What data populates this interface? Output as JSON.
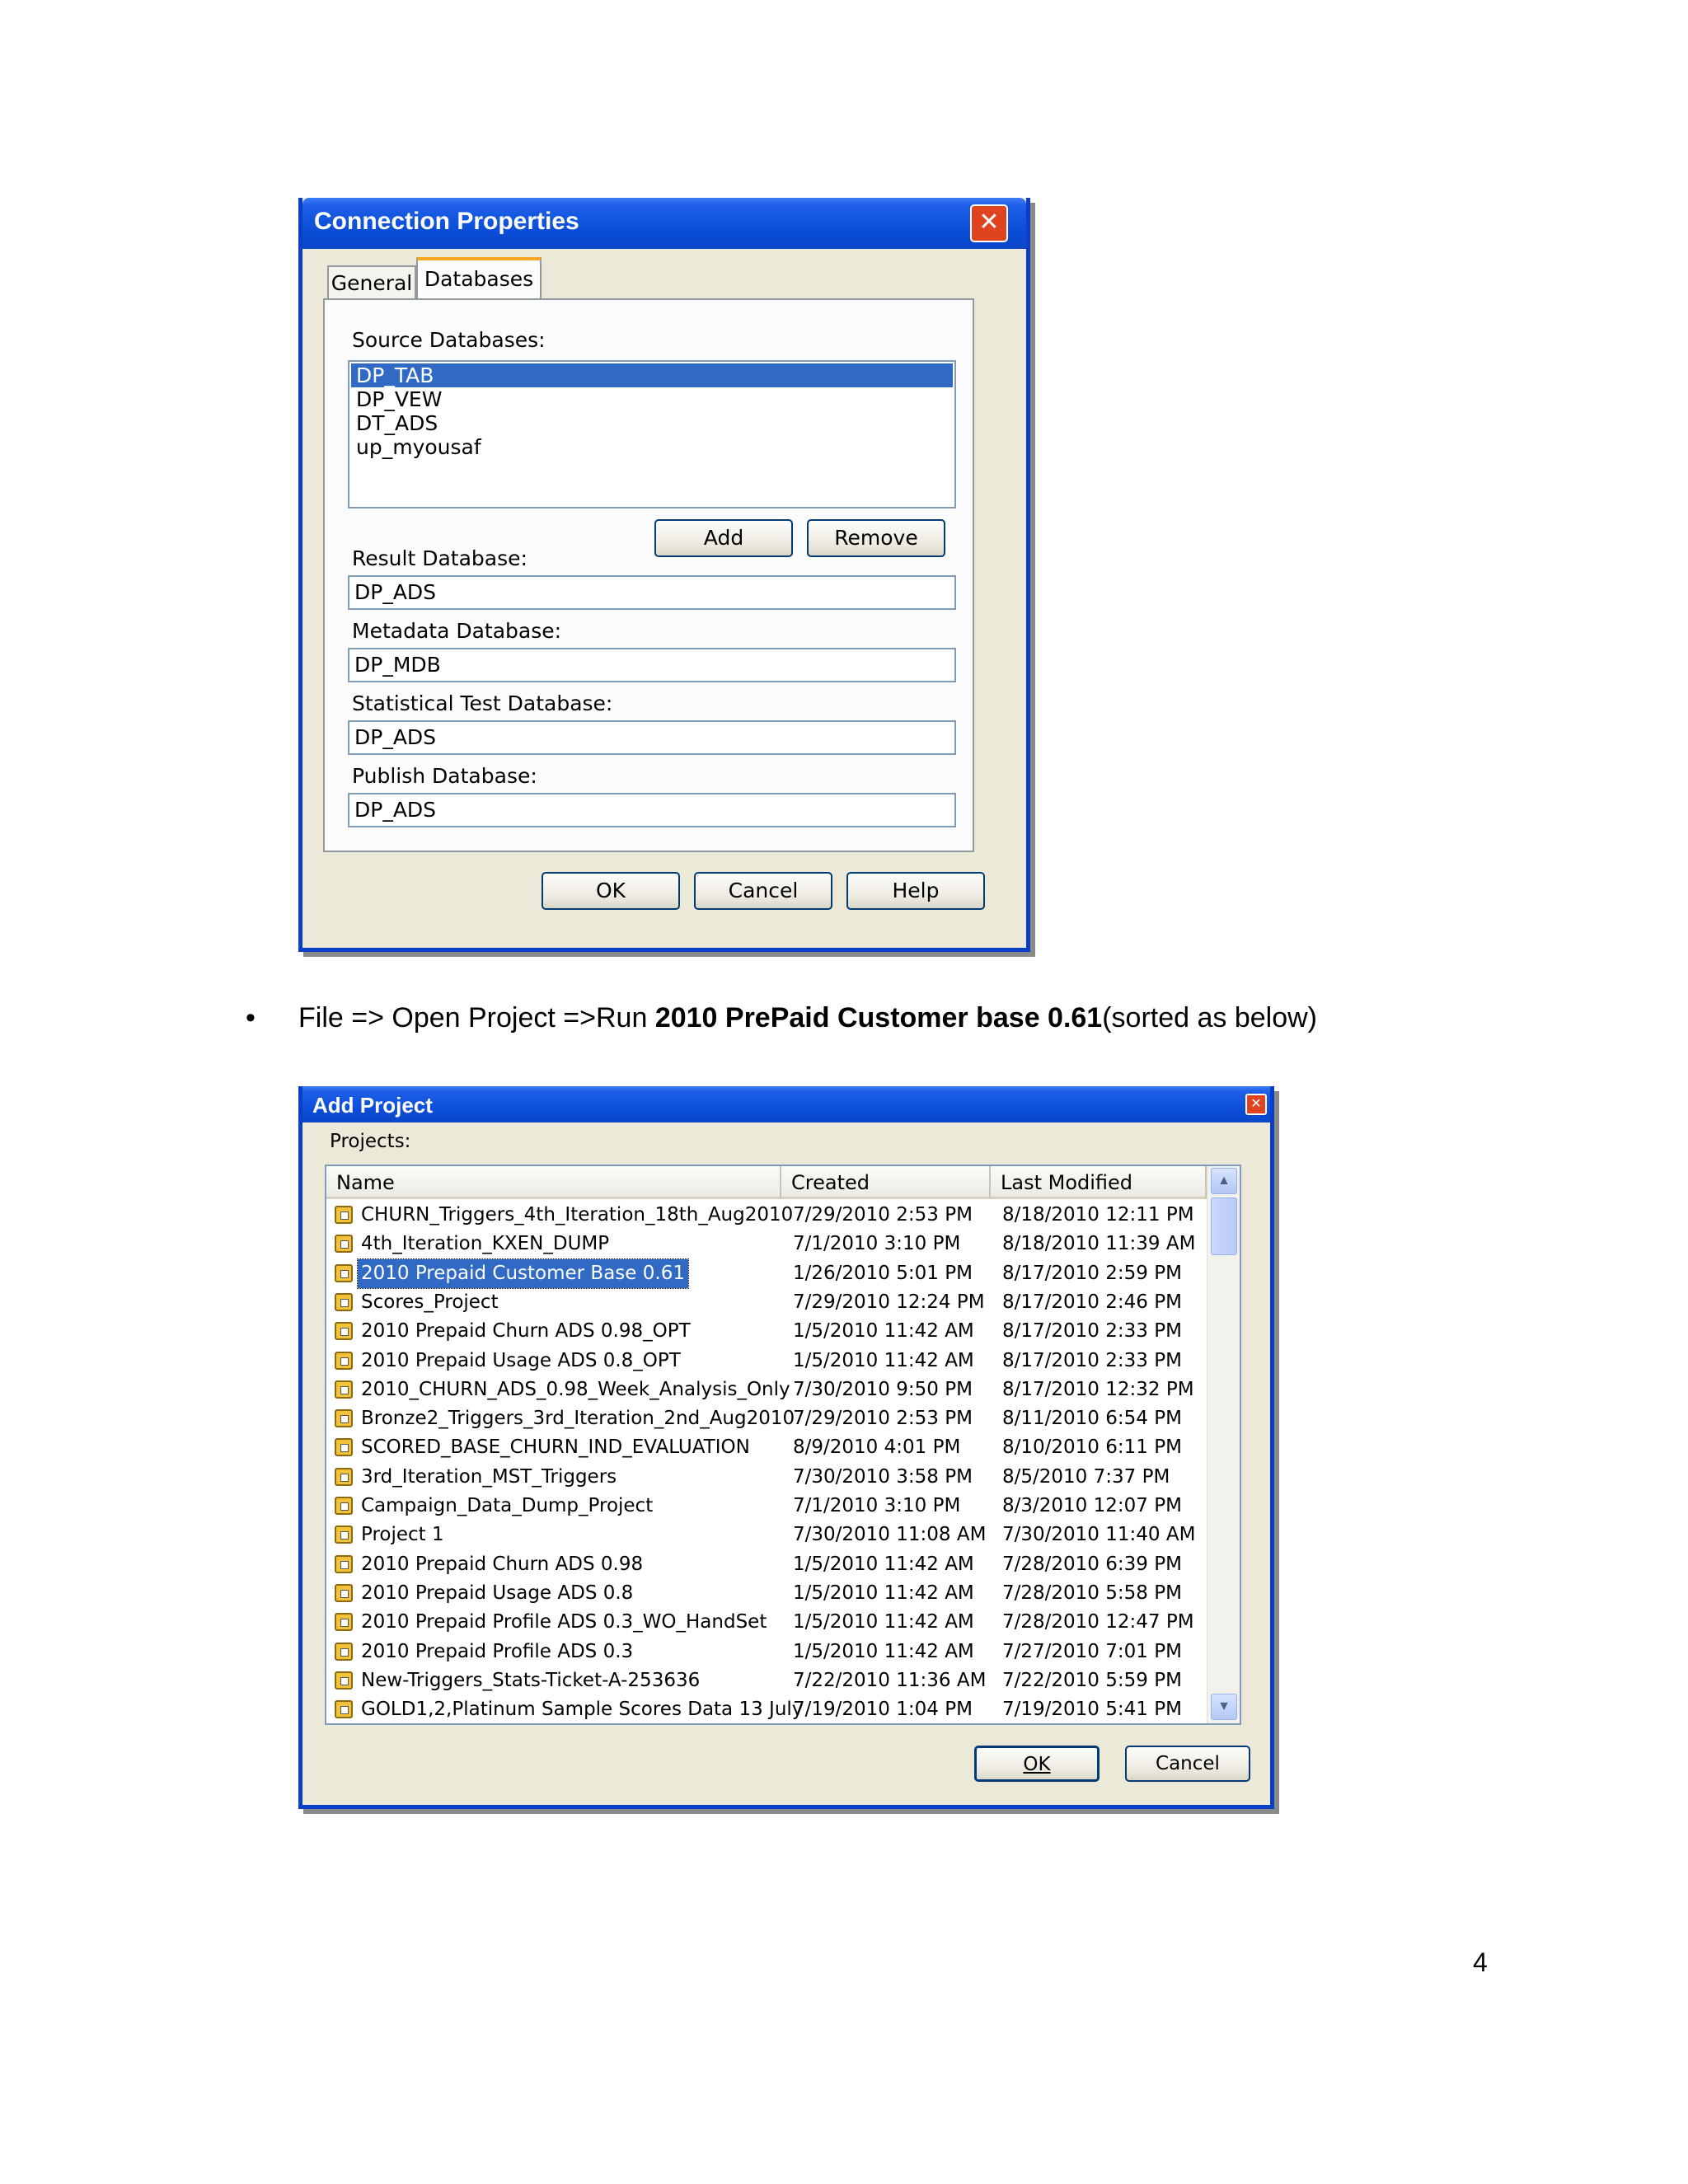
{
  "connection_dialog": {
    "title": "Connection Properties",
    "close_icon": "close-icon",
    "tabs": [
      "General",
      "Databases"
    ],
    "active_tab": "Databases",
    "source_label": "Source Databases:",
    "source_databases": [
      "DP_TAB",
      "DP_VEW",
      "DT_ADS",
      "up_myousaf"
    ],
    "selected_source": "DP_TAB",
    "add_label": "Add",
    "remove_label": "Remove",
    "result_label": "Result Database:",
    "result_value": "DP_ADS",
    "metadata_label": "Metadata Database:",
    "metadata_value": "DP_MDB",
    "stat_label": "Statistical Test Database:",
    "stat_value": "DP_ADS",
    "publish_label": "Publish Database:",
    "publish_value": "DP_ADS",
    "ok_label": "OK",
    "cancel_label": "Cancel",
    "help_label": "Help"
  },
  "caption": {
    "bullet": "•",
    "prefix": "File => Open Project =>Run ",
    "bold": "2010 PrePaid Customer base 0.61",
    "suffix": "(sorted as below)"
  },
  "add_project_dialog": {
    "title": "Add Project",
    "projects_label": "Projects:",
    "columns": [
      "Name",
      "Created",
      "Last Modified"
    ],
    "rows": [
      {
        "name": "CHURN_Triggers_4th_Iteration_18th_Aug2010",
        "created": "7/29/2010 2:53 PM",
        "modified": "8/18/2010 12:11 PM"
      },
      {
        "name": "4th_Iteration_KXEN_DUMP",
        "created": "7/1/2010 3:10 PM",
        "modified": "8/18/2010 11:39 AM"
      },
      {
        "name": "2010 Prepaid Customer Base 0.61",
        "created": "1/26/2010 5:01 PM",
        "modified": "8/17/2010 2:59 PM"
      },
      {
        "name": "Scores_Project",
        "created": "7/29/2010 12:24 PM",
        "modified": "8/17/2010 2:46 PM"
      },
      {
        "name": "2010 Prepaid Churn ADS 0.98_OPT",
        "created": "1/5/2010 11:42 AM",
        "modified": "8/17/2010 2:33 PM"
      },
      {
        "name": "2010 Prepaid Usage ADS 0.8_OPT",
        "created": "1/5/2010 11:42 AM",
        "modified": "8/17/2010 2:33 PM"
      },
      {
        "name": "2010_CHURN_ADS_0.98_Week_Analysis_Only",
        "created": "7/30/2010 9:50 PM",
        "modified": "8/17/2010 12:32 PM"
      },
      {
        "name": "Bronze2_Triggers_3rd_Iteration_2nd_Aug2010",
        "created": "7/29/2010 2:53 PM",
        "modified": "8/11/2010 6:54 PM"
      },
      {
        "name": "SCORED_BASE_CHURN_IND_EVALUATION",
        "created": "8/9/2010 4:01 PM",
        "modified": "8/10/2010 6:11 PM"
      },
      {
        "name": "3rd_Iteration_MST_Triggers",
        "created": "7/30/2010 3:58 PM",
        "modified": "8/5/2010 7:37 PM"
      },
      {
        "name": "Campaign_Data_Dump_Project",
        "created": "7/1/2010 3:10 PM",
        "modified": "8/3/2010 12:07 PM"
      },
      {
        "name": "Project 1",
        "created": "7/30/2010 11:08 AM",
        "modified": "7/30/2010 11:40 AM"
      },
      {
        "name": "2010 Prepaid Churn ADS 0.98",
        "created": "1/5/2010 11:42 AM",
        "modified": "7/28/2010 6:39 PM"
      },
      {
        "name": "2010 Prepaid Usage ADS 0.8",
        "created": "1/5/2010 11:42 AM",
        "modified": "7/28/2010 5:58 PM"
      },
      {
        "name": "2010 Prepaid Profile ADS 0.3_WO_HandSet",
        "created": "1/5/2010 11:42 AM",
        "modified": "7/28/2010 12:47 PM"
      },
      {
        "name": "2010 Prepaid Profile ADS 0.3",
        "created": "1/5/2010 11:42 AM",
        "modified": "7/27/2010 7:01 PM"
      },
      {
        "name": "New-Triggers_Stats-Ticket-A-253636",
        "created": "7/22/2010 11:36 AM",
        "modified": "7/22/2010 5:59 PM"
      },
      {
        "name": "GOLD1,2,Platinum Sample Scores Data 13 July",
        "created": "7/19/2010 1:04 PM",
        "modified": "7/19/2010 5:41 PM"
      }
    ],
    "selected_row": "2010 Prepaid Customer Base 0.61",
    "ok_label": "OK",
    "cancel_label": "Cancel"
  },
  "page_number": "4"
}
